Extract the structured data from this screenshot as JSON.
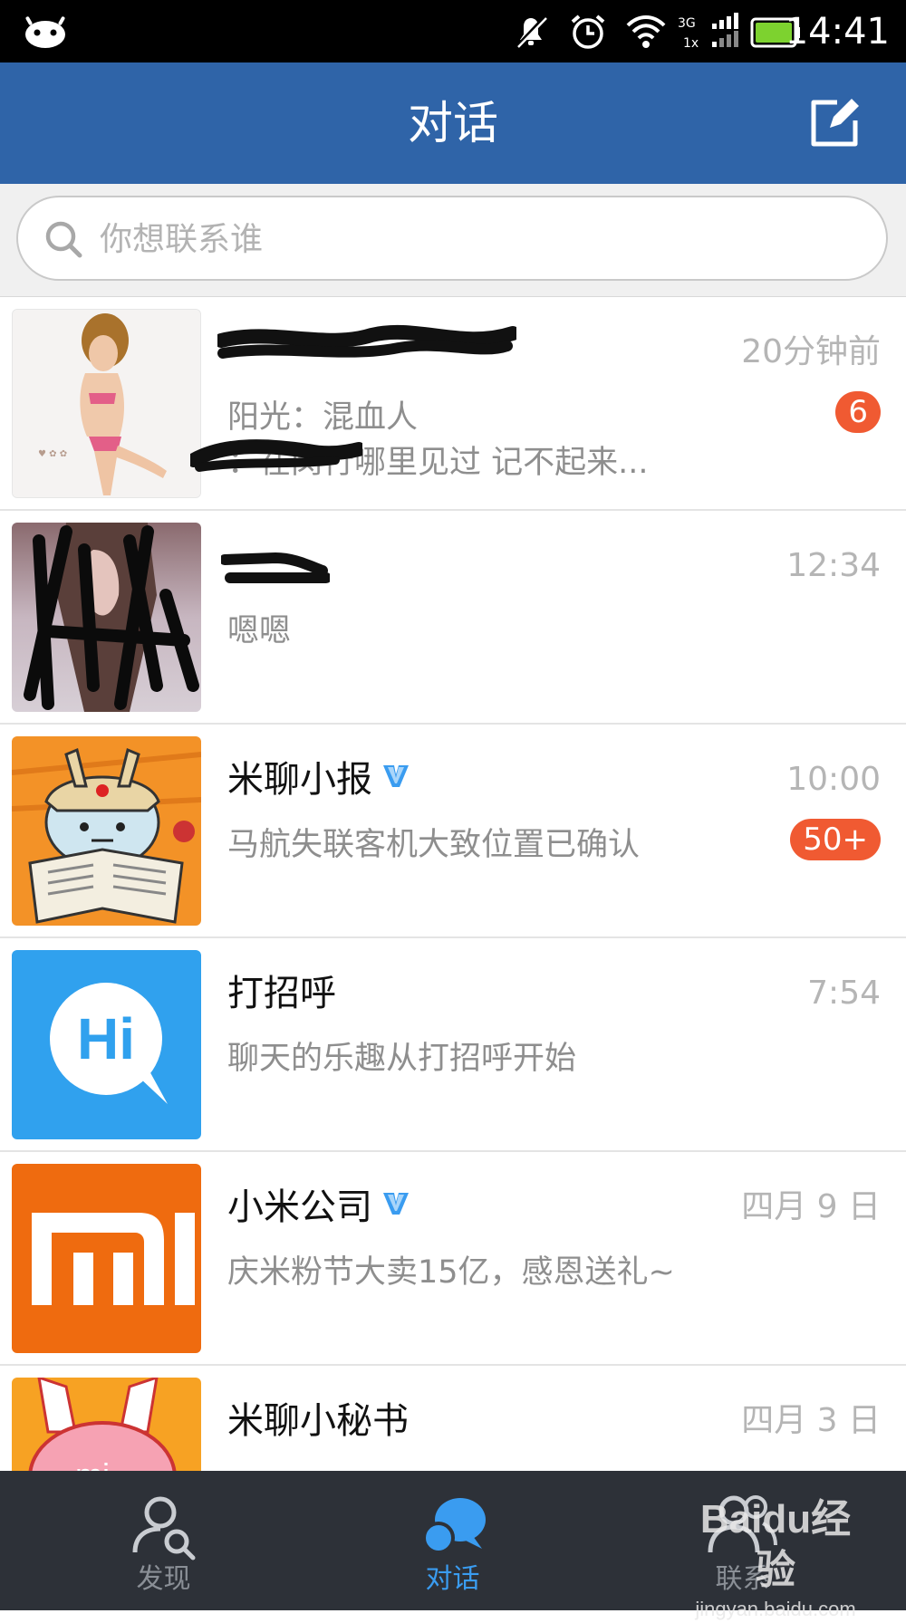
{
  "status_bar": {
    "time": "14:41",
    "network": "3G",
    "network_secondary": "1x",
    "icons": [
      "android-icon",
      "mute-icon",
      "alarm-icon",
      "wifi-icon",
      "signal-icon",
      "battery-icon"
    ]
  },
  "header": {
    "title": "对话",
    "compose_icon": "compose-icon"
  },
  "search": {
    "placeholder": "你想联系谁",
    "value": ""
  },
  "conversations": [
    {
      "name": "",
      "time": "20分钟前",
      "preview": "阳光：混血人",
      "preview_line2": "：在闵行哪里见过 记不起来...",
      "unread": "6",
      "verified": false,
      "avatar": "photo-avatar"
    },
    {
      "name": "",
      "time": "12:34",
      "preview": "嗯嗯",
      "unread": "",
      "verified": false,
      "avatar": "photo-avatar"
    },
    {
      "name": "米聊小报",
      "time": "10:00",
      "preview": "马航失联客机大致位置已确认",
      "unread": "50+",
      "verified": true,
      "avatar": "mitu-newspaper-avatar"
    },
    {
      "name": "打招呼",
      "time": "7:54",
      "preview": "聊天的乐趣从打招呼开始",
      "unread": "",
      "verified": false,
      "avatar": "hi-bubble-avatar"
    },
    {
      "name": "小米公司",
      "time": "四月 9 日",
      "preview": "庆米粉节大卖15亿，感恩送礼~",
      "unread": "",
      "verified": true,
      "avatar": "mi-logo-avatar"
    },
    {
      "name": "米聊小秘书",
      "time": "四月 3 日",
      "preview": "",
      "unread": "",
      "verified": false,
      "avatar": "mitu-avatar"
    }
  ],
  "tabs": [
    {
      "label": "发现",
      "icon": "discover-icon",
      "active": false
    },
    {
      "label": "对话",
      "icon": "chat-icon",
      "active": true
    },
    {
      "label": "联系",
      "icon": "contacts-icon",
      "active": false
    }
  ],
  "watermark": {
    "brand": "Baidu经验",
    "url": "jingyan.baidu.com"
  },
  "colors": {
    "header_bg": "#2f64a8",
    "tab_bg": "#2d3138",
    "active_tab": "#3a9cf0",
    "badge": "#f05a32",
    "verified": "#3a9cf0"
  }
}
